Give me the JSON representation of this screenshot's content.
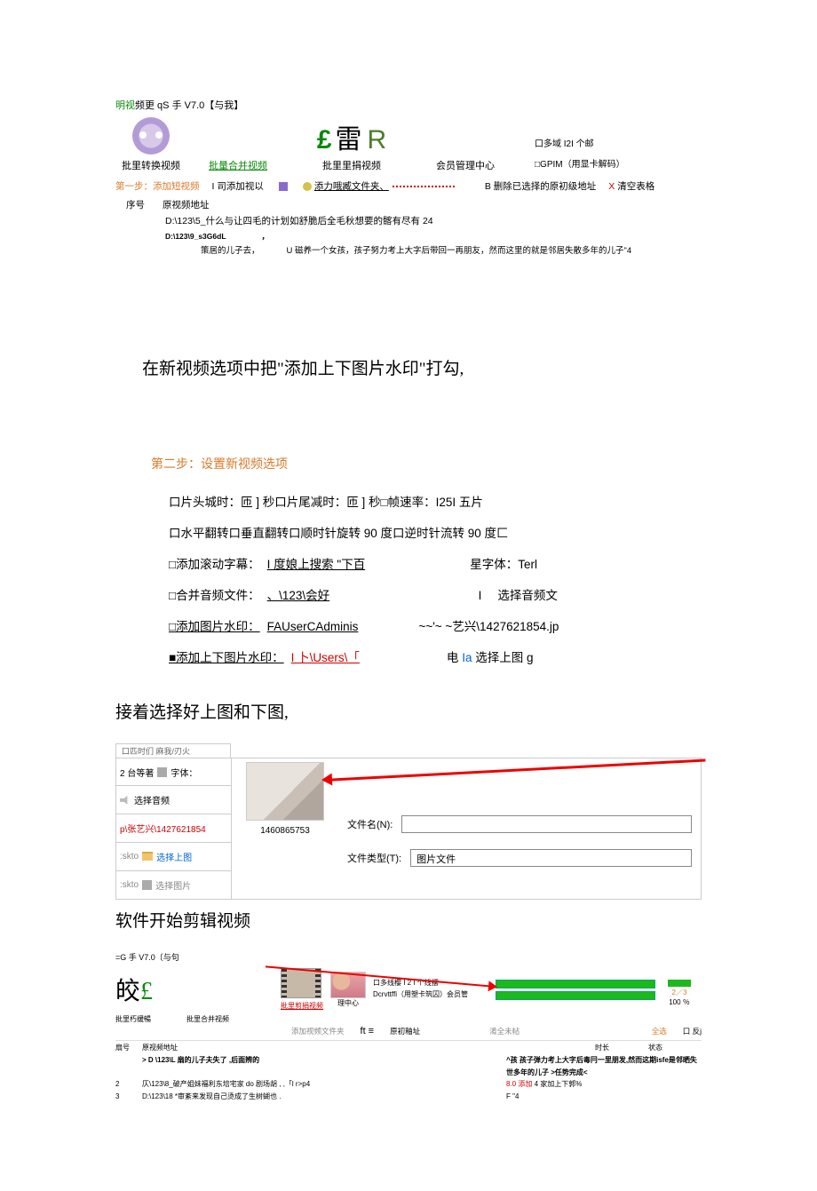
{
  "header": {
    "title_prefix_green": "明视",
    "title_rest": "频更 qS 手 V7.0【与我】",
    "col1_label": "批里转换视频",
    "col2_label": "批量合并视频",
    "col3_label": "批里里捐视频",
    "col4_label": "会员管理中心",
    "lei_pound": "£",
    "lei_char": "雷",
    "lei_r": "R",
    "side_line1": "口多域 I2I 个邮",
    "side_line2": "□GPIM（用显卡解码）"
  },
  "bar": {
    "step1": "第一步：添加短视频",
    "add_btn": "I 司添加视以",
    "add_folder": "添力哦臧文件夹、",
    "delete_btn": "B 删除已选择的原初级地址",
    "clear_btn_prefix": "X",
    "clear_btn": "清空表格"
  },
  "table": {
    "col_num": "序号",
    "col_path": "原视频地址",
    "row1": "D:\\123\\5_什么与让四毛的计划如舒脆后全毛秋想要的髂有尽有 24",
    "row2": "D:\\123\\9_s3G6dL",
    "row2_comma": "，",
    "row3a": "策居的儿子去，",
    "row3b": "U 磁养一个女孩，孩子努力考上大字后带回一再朋友，然而这里的就是邻居失散多年的儿子\"4"
  },
  "body1": "在新视频选项中把\"添加上下图片水印\"打勾,",
  "step2_title": "第二步：设置新视频选项",
  "opts": {
    "l1": "口片头城时：匝 ] 秒口片尾减时：匝 ] 秒□帧速率：I25I 五片",
    "l2": "口水平翻转口垂直翻转口顺时针旋转 90 度口逆时针流转 90 度匚",
    "l3a": "□添加滚动字幕：",
    "l3b": "I 度娘上搜索 \"下百",
    "l3c": "星字体：Terl",
    "l4a": "□合并音频文件：",
    "l4b": "、\\123\\会好",
    "l4c": "I",
    "l4d": "选择音频文",
    "l5a": "□添加图片水印：",
    "l5b": "FAUserCAdminis",
    "l5c": "~~'~ ~艺兴\\1427621854.jp",
    "l6a": "■添加上下图片水印：",
    "l6b": "I 卜\\Users\\「",
    "l6c": "电 ",
    "l6c_blue": "Ia ",
    "l6d": "选择上图 g"
  },
  "body2": "接着选择好上图和下图,",
  "shot2": {
    "top_strip": "口匹时们 麻我/刃火",
    "c1": "2 台等著",
    "c1b": "字体：",
    "c2": "选择音频",
    "c3": "p\\张艺兴\\1427621854",
    "c4_pre": ":skto",
    "c4_btn": "选择上图",
    "c5_pre": ":skto",
    "c5_btn": "选择图片",
    "thumb_caption": "1460865753",
    "filename_label": "文件名(N):",
    "filename_value": "",
    "filetype_label": "文件类型(T):",
    "filetype_value": "图片文件"
  },
  "body3": "软件开始剪辑视频",
  "shot3": {
    "title": "=G 手 V7.0〔与句",
    "jiao": "皎",
    "pound": "£",
    "lab_left": "批里朽缓暢",
    "lab_merge": "批里合并视频",
    "lab_clip": "批里剪捐视频",
    "lab_center": "理中心",
    "multi_thread": "口多线樱 I 2 I 个线摆",
    "decode": "Dcrvttffi（用塑卡筑囚）会员管",
    "pct_a": "2／3",
    "pct_b": "100 ％",
    "line2_add": "添加视频文件夹",
    "line2_ft": "ft ≡",
    "line2_orig": "原初釉址",
    "line2_clear": "淆全未帖",
    "line2_all": "全选",
    "line2_inv": "口   反j",
    "th_num": "扇号",
    "th_path": "原视频地址",
    "th_dur": "时长",
    "th_status": "状态",
    "r1_a": "> D \\123\\L 扇的儿子夫失了 ,后面辨的",
    "r1_b": "^孩 孩子弹力考上大字后毒冃一里朋发,然而这期isfe是邻晒失世多年的儿子 >任势完成<",
    "r2_a": "2",
    "r2_b": "仄\\123\\8_破产姐妹福利东培宅家 do 剧场胡 , ,「l r>p4",
    "r2_c": "8.0 添加",
    "r2_d": "4 家加上下郭%",
    "r3_a": "3",
    "r3_b": "D:\\123\\18 *审紊来发现自己烫成了生树蝴也 .",
    "r3_c": "F \"4"
  }
}
